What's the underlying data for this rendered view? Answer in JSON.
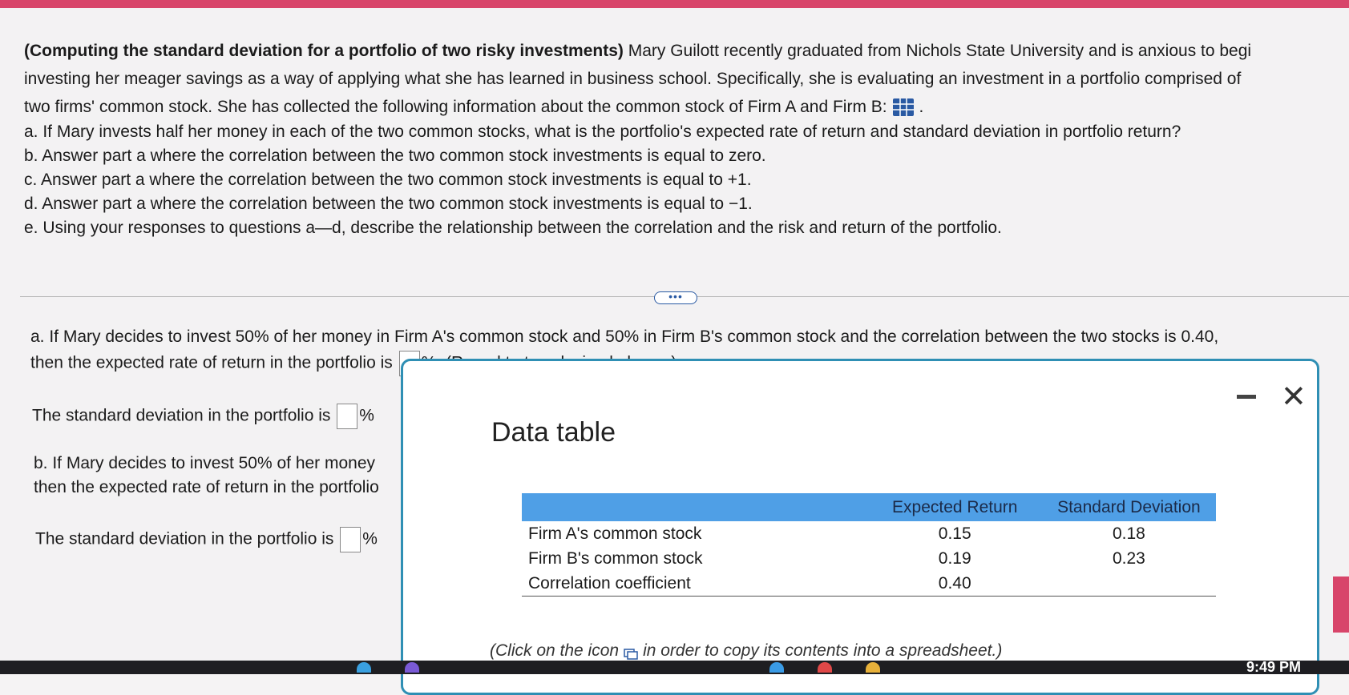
{
  "problem": {
    "title": "(Computing the standard deviation for a portfolio of two risky investments)",
    "line1_rest": " Mary Guilott recently graduated from Nichols State University and is anxious to begi",
    "line2": "investing her meager savings as a way of applying what she has learned in business school. Specifically, she is evaluating an investment in a portfolio comprised of",
    "line3": "two firms' common stock. She has collected the following information about the common stock of Firm A and Firm B:"
  },
  "questions": [
    "a. If Mary invests half her money in each of the two common stocks, what is the portfolio's expected rate of return and standard deviation in portfolio return?",
    "b. Answer part a where the correlation between the two common stock investments is equal to zero.",
    "c. Answer part a where the correlation between the two common stock investments is equal to +1.",
    "d. Answer part a where the correlation between the two common stock investments is equal to −1.",
    "e. Using your responses to questions a—d, describe the relationship between the correlation and the risk and return of the portfolio."
  ],
  "ellipsis": "•••",
  "answer_a": {
    "line1": "a. If Mary decides to invest 50% of her money in Firm A's common stock and 50% in Firm B's common stock and the correlation between the two stocks is 0.40,",
    "line2_pre": "then the expected rate of return in the portfolio is",
    "line2_post": "%. (Round to two decimal places.)",
    "sd_pre": "The standard deviation in the portfolio is",
    "sd_post": "%"
  },
  "answer_b": {
    "line1": "b. If Mary decides to invest 50% of her money",
    "line2": "then the expected rate of return in the portfolio",
    "sd_pre": "The standard deviation in the portfolio is",
    "sd_post": "%"
  },
  "modal": {
    "title": "Data table",
    "minimize": "—",
    "close": "✕",
    "headers": [
      "",
      "Expected Return",
      "Standard Deviation"
    ],
    "rows": [
      {
        "label": "Firm A's common stock",
        "expected": "0.15",
        "sd": "0.18"
      },
      {
        "label": "Firm B's common stock",
        "expected": "0.19",
        "sd": "0.23"
      },
      {
        "label": "Correlation coefficient",
        "expected": "0.40",
        "sd": ""
      }
    ],
    "copy_note_pre": "(Click on the icon",
    "copy_note_post": "in order to copy its contents into a spreadsheet.)"
  },
  "taskbar": {
    "clock": "9:49 PM"
  }
}
